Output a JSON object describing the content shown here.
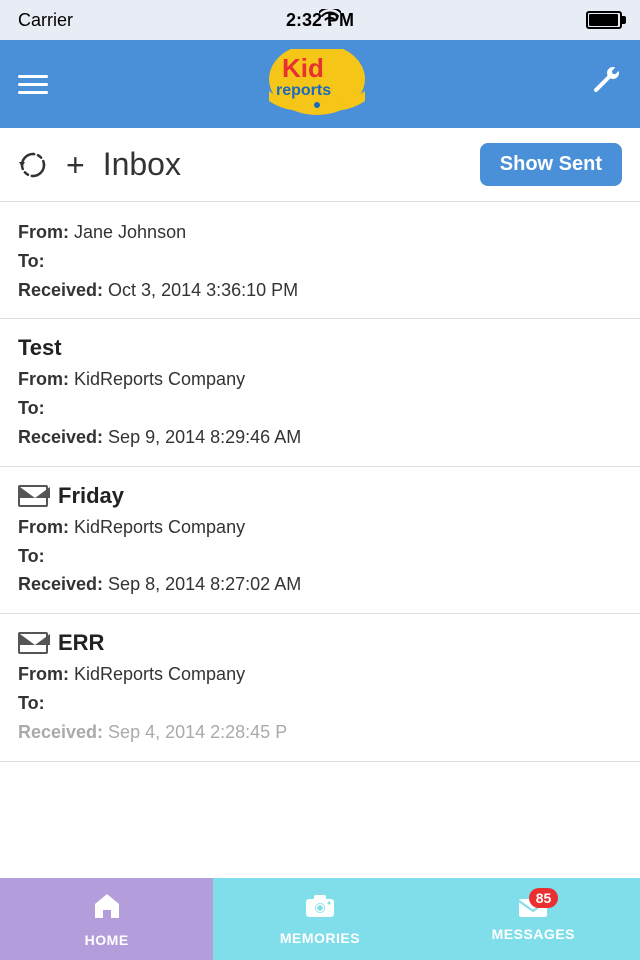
{
  "statusBar": {
    "carrier": "Carrier",
    "time": "2:32 PM"
  },
  "navBar": {
    "logoTextKid": "Kid",
    "logoTextReports": "reports",
    "wrenchLabel": "settings"
  },
  "toolbar": {
    "title": "Inbox",
    "showSentLabel": "Show Sent"
  },
  "messages": [
    {
      "id": 1,
      "hasIcon": false,
      "subject": null,
      "from": "Jane Johnson",
      "to": "",
      "received": "Oct 3, 2014 3:36:10 PM"
    },
    {
      "id": 2,
      "hasIcon": false,
      "subject": "Test",
      "from": "KidReports Company",
      "to": "",
      "received": "Sep 9, 2014 8:29:46 AM"
    },
    {
      "id": 3,
      "hasIcon": true,
      "subject": "Friday",
      "from": "KidReports Company",
      "to": "",
      "received": "Sep 8, 2014 8:27:02 AM"
    },
    {
      "id": 4,
      "hasIcon": true,
      "subject": "ERR",
      "from": "KidReports Company",
      "to": "",
      "received": "Sep 4, 2014 2:28:45 P"
    }
  ],
  "tabBar": {
    "items": [
      {
        "id": "home",
        "label": "HOME",
        "icon": "house"
      },
      {
        "id": "memories",
        "label": "MEMORIES",
        "icon": "camera"
      },
      {
        "id": "messages",
        "label": "MESSAGES",
        "icon": "envelope",
        "badge": "85"
      }
    ]
  }
}
